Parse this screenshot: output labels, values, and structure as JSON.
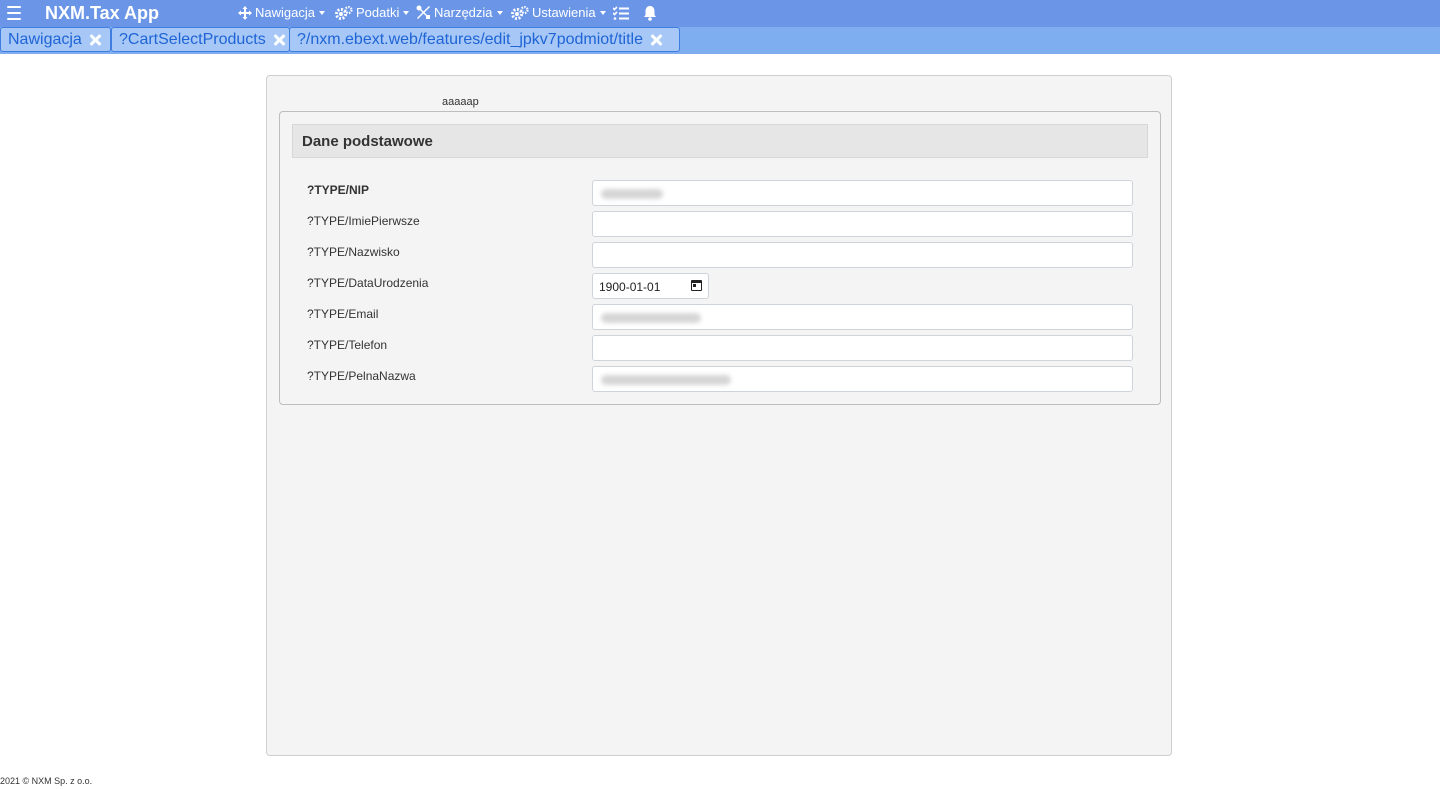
{
  "navbar": {
    "brand": "NXM.Tax App",
    "menus": [
      {
        "label": "Nawigacja",
        "icon": "move-arrows-icon"
      },
      {
        "label": "Podatki",
        "icon": "gears-icon"
      },
      {
        "label": "Narzędzia",
        "icon": "tools-icon"
      },
      {
        "label": "Ustawienia",
        "icon": "gears-icon"
      }
    ],
    "icons": [
      "menu-icon",
      "tasks-list-icon",
      "bell-icon"
    ],
    "color": "#6b96e8"
  },
  "tabs": [
    {
      "label": "Nawigacja"
    },
    {
      "label": "?CartSelectProducts"
    },
    {
      "label": "?/nxm.ebext.web/features/edit_jpkv7podmiot/title"
    }
  ],
  "panel": {
    "caption": "aaaaap",
    "section_title": "Dane podstawowe",
    "fields": [
      {
        "label": "?TYPE/NIP",
        "value": ""
      },
      {
        "label": "?TYPE/ImiePierwsze",
        "value": ""
      },
      {
        "label": "?TYPE/Nazwisko",
        "value": ""
      },
      {
        "label": "?TYPE/DataUrodzenia",
        "value": "1900-01-01"
      },
      {
        "label": "?TYPE/Email",
        "value": ""
      },
      {
        "label": "?TYPE/Telefon",
        "value": ""
      },
      {
        "label": "?TYPE/PelnaNazwa",
        "value": ""
      }
    ]
  },
  "footer": "2021 © NXM Sp. z o.o."
}
